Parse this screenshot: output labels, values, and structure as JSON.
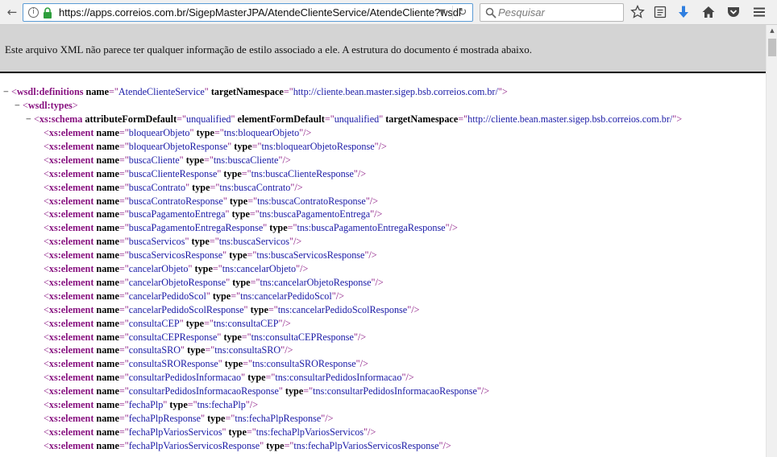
{
  "browser": {
    "url": "https://apps.correios.com.br/SigepMasterJPA/AtendeClienteService/AtendeCliente?wsdl",
    "search_placeholder": "Pesquisar",
    "icons": [
      "back-icon",
      "info-icon",
      "lock-icon",
      "dropdown-icon",
      "reload-icon",
      "search-icon",
      "bookmark-star-icon",
      "reading-list-icon",
      "download-icon",
      "home-icon",
      "pocket-icon",
      "menu-icon"
    ]
  },
  "banner": {
    "text": "Este arquivo XML não parece ter qualquer informação de estilo associado a ele. A estrutura do documento é mostrada abaixo."
  },
  "xml": {
    "definitions": {
      "toggle": "−",
      "tag": "wsdl:definitions",
      "attrs": [
        {
          "name": "name",
          "value": "AtendeClienteService"
        },
        {
          "name": "targetNamespace",
          "value": "http://cliente.bean.master.sigep.bsb.correios.com.br/"
        }
      ]
    },
    "types": {
      "toggle": "−",
      "tag": "wsdl:types"
    },
    "schema": {
      "toggle": "−",
      "tag": "xs:schema",
      "attrs": [
        {
          "name": "attributeFormDefault",
          "value": "unqualified"
        },
        {
          "name": "elementFormDefault",
          "value": "unqualified"
        },
        {
          "name": "targetNamespace",
          "value": "http://cliente.bean.master.sigep.bsb.correios.com.br/"
        }
      ]
    },
    "element_tag": "xs:element",
    "elements": [
      {
        "name": "bloquearObjeto",
        "type": "tns:bloquearObjeto"
      },
      {
        "name": "bloquearObjetoResponse",
        "type": "tns:bloquearObjetoResponse"
      },
      {
        "name": "buscaCliente",
        "type": "tns:buscaCliente"
      },
      {
        "name": "buscaClienteResponse",
        "type": "tns:buscaClienteResponse"
      },
      {
        "name": "buscaContrato",
        "type": "tns:buscaContrato"
      },
      {
        "name": "buscaContratoResponse",
        "type": "tns:buscaContratoResponse"
      },
      {
        "name": "buscaPagamentoEntrega",
        "type": "tns:buscaPagamentoEntrega"
      },
      {
        "name": "buscaPagamentoEntregaResponse",
        "type": "tns:buscaPagamentoEntregaResponse"
      },
      {
        "name": "buscaServicos",
        "type": "tns:buscaServicos"
      },
      {
        "name": "buscaServicosResponse",
        "type": "tns:buscaServicosResponse"
      },
      {
        "name": "cancelarObjeto",
        "type": "tns:cancelarObjeto"
      },
      {
        "name": "cancelarObjetoResponse",
        "type": "tns:cancelarObjetoResponse"
      },
      {
        "name": "cancelarPedidoScol",
        "type": "tns:cancelarPedidoScol"
      },
      {
        "name": "cancelarPedidoScolResponse",
        "type": "tns:cancelarPedidoScolResponse"
      },
      {
        "name": "consultaCEP",
        "type": "tns:consultaCEP"
      },
      {
        "name": "consultaCEPResponse",
        "type": "tns:consultaCEPResponse"
      },
      {
        "name": "consultaSRO",
        "type": "tns:consultaSRO"
      },
      {
        "name": "consultaSROResponse",
        "type": "tns:consultaSROResponse"
      },
      {
        "name": "consultarPedidosInformacao",
        "type": "tns:consultarPedidosInformacao"
      },
      {
        "name": "consultarPedidosInformacaoResponse",
        "type": "tns:consultarPedidosInformacaoResponse"
      },
      {
        "name": "fechaPlp",
        "type": "tns:fechaPlp"
      },
      {
        "name": "fechaPlpResponse",
        "type": "tns:fechaPlpResponse"
      },
      {
        "name": "fechaPlpVariosServicos",
        "type": "tns:fechaPlpVariosServicos"
      },
      {
        "name": "fechaPlpVariosServicosResponse",
        "type": "tns:fechaPlpVariosServicosResponse"
      }
    ]
  }
}
